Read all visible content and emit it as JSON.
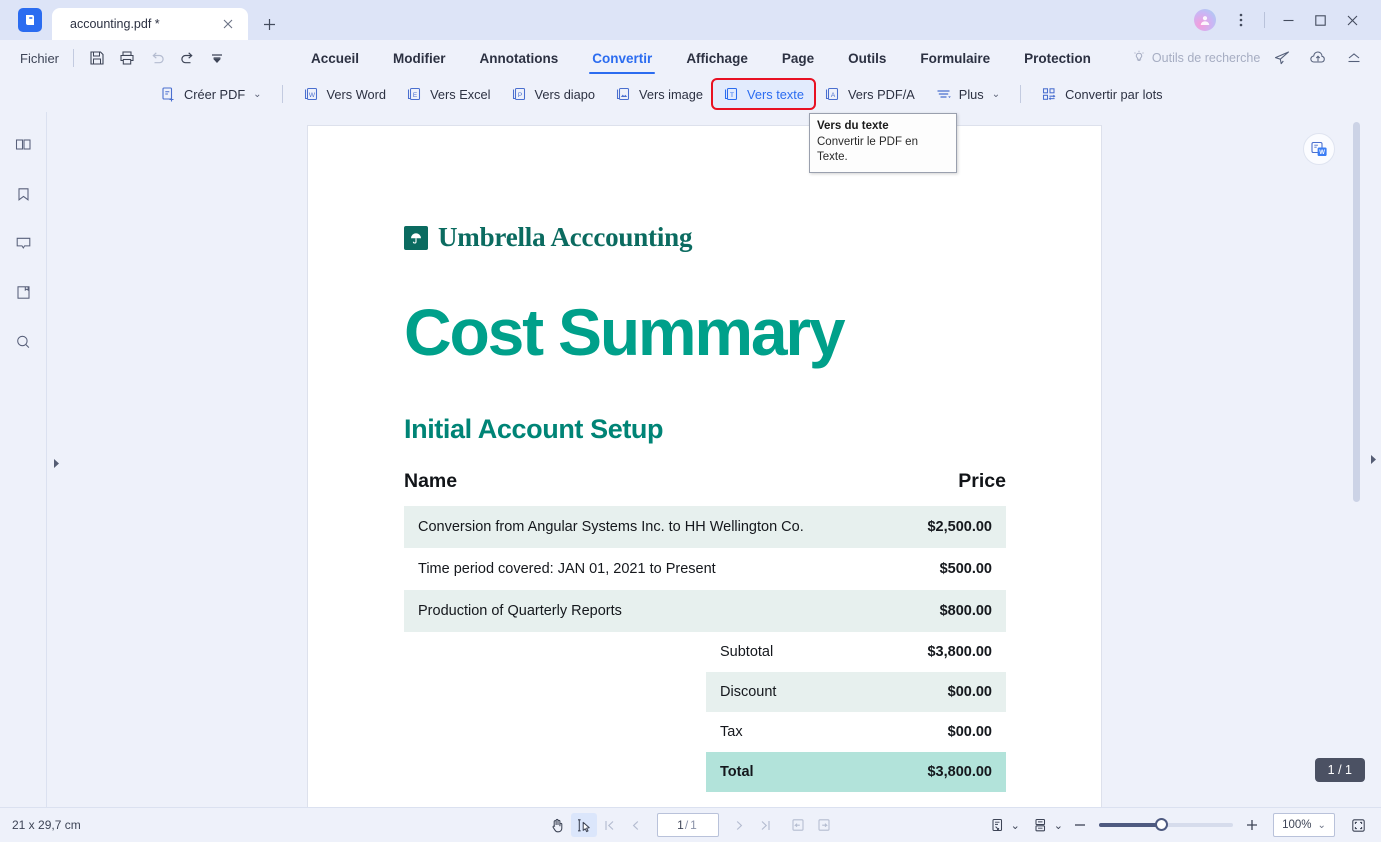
{
  "window": {
    "app_logo": "pdfelement-logo",
    "tab": {
      "title": "accounting.pdf *",
      "close_icon": "close-icon"
    },
    "new_tab_icon": "plus-icon",
    "avatar": "user-avatar",
    "more_icon": "more-vertical-icon",
    "minimize_icon": "minimize-icon",
    "maximize_icon": "maximize-icon",
    "close_icon": "window-close-icon"
  },
  "menu": {
    "file_label": "Fichier",
    "quick_actions": [
      {
        "name": "save-icon",
        "label": "Enregistrer",
        "disabled": false
      },
      {
        "name": "print-icon",
        "label": "Imprimer",
        "disabled": false
      },
      {
        "name": "undo-icon",
        "label": "Annuler",
        "disabled": true
      },
      {
        "name": "redo-icon",
        "label": "Rétablir",
        "disabled": false
      },
      {
        "name": "customize-dropdown-icon",
        "label": "Personnaliser",
        "disabled": false
      }
    ],
    "tabs": [
      {
        "label": "Accueil",
        "active": false
      },
      {
        "label": "Modifier",
        "active": false
      },
      {
        "label": "Annotations",
        "active": false
      },
      {
        "label": "Convertir",
        "active": true
      },
      {
        "label": "Affichage",
        "active": false
      },
      {
        "label": "Page",
        "active": false
      },
      {
        "label": "Outils",
        "active": false
      },
      {
        "label": "Formulaire",
        "active": false
      },
      {
        "label": "Protection",
        "active": false
      }
    ],
    "search_tools": {
      "icon": "lightbulb-icon",
      "label": "Outils de recherche"
    },
    "right_icons": [
      {
        "name": "send-icon",
        "label": "Partager"
      },
      {
        "name": "cloud-upload-icon",
        "label": "Téléverser"
      },
      {
        "name": "collapse-ribbon-icon",
        "label": "Réduire le ruban"
      }
    ]
  },
  "ribbon": {
    "buttons": [
      {
        "label": "Créer PDF",
        "icon": "create-pdf-icon",
        "caret": "⌄",
        "highlight": false
      },
      {
        "label": "Vers Word",
        "icon": "to-word-icon",
        "caret": "",
        "highlight": false
      },
      {
        "label": "Vers Excel",
        "icon": "to-excel-icon",
        "caret": "",
        "highlight": false
      },
      {
        "label": "Vers diapo",
        "icon": "to-ppt-icon",
        "caret": "",
        "highlight": false
      },
      {
        "label": "Vers image",
        "icon": "to-image-icon",
        "caret": "",
        "highlight": false
      },
      {
        "label": "Vers texte",
        "icon": "to-text-icon",
        "caret": "",
        "highlight": true
      },
      {
        "label": "Vers PDF/A",
        "icon": "to-pdfa-icon",
        "caret": "",
        "highlight": false
      },
      {
        "label": "Plus",
        "icon": "more-options-icon",
        "caret": "⌄",
        "highlight": false
      },
      {
        "label": "Convertir par lots",
        "icon": "batch-convert-icon",
        "caret": "",
        "highlight": false
      }
    ],
    "highlight_color": "#e81123"
  },
  "tooltip": {
    "title": "Vers du texte",
    "body": "Convertir le PDF en Texte."
  },
  "sidebar": {
    "items": [
      {
        "name": "thumbnails-icon",
        "label": "Vignettes"
      },
      {
        "name": "bookmark-icon",
        "label": "Signets"
      },
      {
        "name": "comment-icon",
        "label": "Commentaires"
      },
      {
        "name": "attachment-icon",
        "label": "Pièces jointes"
      },
      {
        "name": "search-icon",
        "label": "Rechercher"
      }
    ],
    "expand_handle": "expand-panel-arrow"
  },
  "document": {
    "brand_mark": "umbrella-logo",
    "brand_name": "Umbrella Acccounting",
    "title": "Cost Summary",
    "subtitle": "Initial Account Setup",
    "table": {
      "headers": [
        "Name",
        "Price"
      ],
      "rows": [
        {
          "name": "Conversion from Angular Systems Inc. to HH Wellington Co.",
          "price": "$2,500.00",
          "shaded": true
        },
        {
          "name": "Time period covered: JAN 01, 2021 to Present",
          "price": "$500.00",
          "shaded": false
        },
        {
          "name": "Production of Quarterly Reports",
          "price": "$800.00",
          "shaded": true
        }
      ]
    },
    "summary": [
      {
        "label": "Subtotal",
        "value": "$3,800.00",
        "shaded": false,
        "total": false
      },
      {
        "label": "Discount",
        "value": "$00.00",
        "shaded": true,
        "total": false
      },
      {
        "label": "Tax",
        "value": "$00.00",
        "shaded": false,
        "total": false
      },
      {
        "label": "Total",
        "value": "$3,800.00",
        "shaded": false,
        "total": true
      }
    ],
    "colors": {
      "title": "#00a08a",
      "subtitle": "#008476",
      "brand": "#0b6b60",
      "row_shade": "#e7f0ee",
      "total_shade": "#b2e3da"
    }
  },
  "overlay": {
    "convert_word_button": "convert-to-word-icon",
    "page_pill": "1 / 1",
    "right_collapse_arrow": "collapse-right-panel-arrow",
    "left_expand_arrow": "expand-left-panel-arrow"
  },
  "statusbar": {
    "page_size": "21 x 29,7 cm",
    "tools": [
      {
        "name": "hand-tool-icon",
        "label": "Outil main",
        "selected": false,
        "disabled": false
      },
      {
        "name": "select-tool-icon",
        "label": "Outil de sélection",
        "selected": true,
        "disabled": false
      },
      {
        "name": "first-page-icon",
        "label": "Première page",
        "selected": false,
        "disabled": true
      },
      {
        "name": "previous-page-icon",
        "label": "Page précédente",
        "selected": false,
        "disabled": true
      }
    ],
    "page_current": "1",
    "page_total": "1",
    "tools_after": [
      {
        "name": "next-page-icon",
        "label": "Page suivante",
        "disabled": true
      },
      {
        "name": "last-page-icon",
        "label": "Dernière page",
        "disabled": true
      },
      {
        "name": "fit-width-icon",
        "label": "Ajuster la largeur",
        "disabled": true
      },
      {
        "name": "fit-page-icon",
        "label": "Ajuster la page",
        "disabled": true
      }
    ],
    "view_modes": [
      {
        "name": "page-layout-icon",
        "label": "Disposition des pages",
        "caret": "⌄"
      },
      {
        "name": "scroll-mode-icon",
        "label": "Mode de défilement",
        "caret": "⌄"
      }
    ],
    "zoom_out_icon": "zoom-out-icon",
    "zoom_in_icon": "zoom-in-icon",
    "zoom_value": "100%",
    "zoom_caret": "⌄",
    "fullscreen_icon": "fullscreen-icon"
  }
}
